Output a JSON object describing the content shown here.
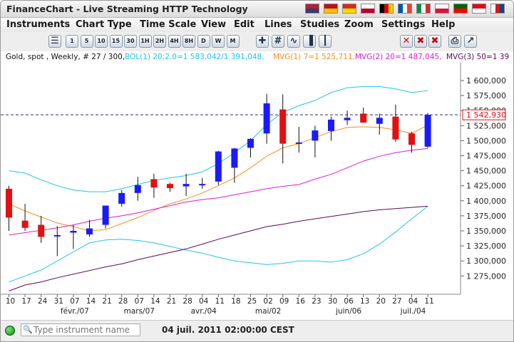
{
  "window": {
    "title": "FinanceChart - Live Streaming HTTP Technology"
  },
  "flags": [
    {
      "name": "us-flag-icon",
      "colors": [
        "#b22234",
        "#3c3b6e"
      ]
    },
    {
      "name": "es-flag-icon",
      "colors": [
        "#c60b1e",
        "#ffc400"
      ]
    },
    {
      "name": "cn-flag-icon",
      "colors": [
        "#de2910",
        "#ffde00"
      ]
    },
    {
      "name": "jp-flag-icon",
      "colors": [
        "#ffffff",
        "#bc002d"
      ]
    },
    {
      "name": "de-flag-icon",
      "colors": [
        "#000000",
        "#dd0000",
        "#ffce00"
      ]
    },
    {
      "name": "fr-flag-icon",
      "colors": [
        "#0055a4",
        "#ffffff",
        "#ef4135"
      ]
    },
    {
      "name": "it-flag-icon",
      "colors": [
        "#009246",
        "#ffffff",
        "#ce2b37"
      ]
    },
    {
      "name": "pl-flag-icon",
      "colors": [
        "#ffffff",
        "#dc143c"
      ]
    },
    {
      "name": "pt-flag-icon",
      "colors": [
        "#006600",
        "#ff0000"
      ]
    },
    {
      "name": "tr-flag-icon",
      "colors": [
        "#e30a17",
        "#ffffff"
      ]
    },
    {
      "name": "cz-flag-icon",
      "colors": [
        "#ffffff",
        "#d7141a",
        "#11457e"
      ]
    }
  ],
  "menu": [
    "Instruments",
    "Chart Type",
    "Time Scale",
    "View",
    "Edit",
    "Lines",
    "Studies",
    "Zoom",
    "Settings",
    "Help"
  ],
  "toolbar": {
    "scale_buttons": [
      "1",
      "5",
      "10",
      "15",
      "30",
      "1H",
      "2H",
      "4H",
      "8H",
      "D",
      "W",
      "M"
    ],
    "tool_icons": [
      "menu-icon",
      "crosshair-icon",
      "hash-icon",
      "line-chart-icon",
      "bar-chart-icon",
      "candlestick-icon",
      "erase-icon",
      "delete-icon",
      "close-icon",
      "print-icon",
      "pin-icon"
    ]
  },
  "legend": {
    "instrument": "Gold, spot , Weekly, # 27 / 300,",
    "bol": "BOL(1) 20;2.0=1 583,042/1 391,048,",
    "mvg1": "MVG(1) 7=1 525,711,",
    "mvg2": "MVG(2) 20=1 487,045,",
    "mvg3": "MVG(3) 50=1 39"
  },
  "colors": {
    "up": "#1a1aff",
    "down": "#e31010",
    "bol": "#1ec3f0",
    "mvg1": "#ff8c1a",
    "mvg2": "#d81ed8",
    "mvg3": "#5a0a5a",
    "current": "#2a2a7a"
  },
  "status": {
    "search_placeholder": "Type instrument name",
    "datetime": "04 juil. 2011 02:00:00 CEST"
  },
  "chart_data": {
    "type": "candlestick",
    "instrument": "Gold, spot",
    "timeframe": "Weekly",
    "ylim": [
      1255000,
      1615000
    ],
    "y_ticks": [
      "1 275,000",
      "1 300,000",
      "1 325,000",
      "1 350,000",
      "1 375,000",
      "1 400,000",
      "1 425,000",
      "1 450,000",
      "1 475,000",
      "1 500,000",
      "1 525,000",
      "1 550,000",
      "1 575,000",
      "1 600,000"
    ],
    "x_ticks": [
      "10",
      "17",
      "24",
      "31",
      "07",
      "14",
      "21",
      "28",
      "07",
      "14",
      "21",
      "28",
      "04",
      "11",
      "18",
      "25",
      "02",
      "09",
      "16",
      "23",
      "30",
      "06",
      "13",
      "20",
      "27",
      "04",
      "11"
    ],
    "month_labels": [
      {
        "label": "févr./07",
        "at": 4
      },
      {
        "label": "mars/07",
        "at": 8
      },
      {
        "label": "avr./04",
        "at": 12
      },
      {
        "label": "mai/02",
        "at": 16
      },
      {
        "label": "juin/06",
        "at": 21
      },
      {
        "label": "juil./04",
        "at": 25
      }
    ],
    "current_price_label": "1 542,930",
    "current_price": 1542930,
    "candles": [
      {
        "o": 1420000,
        "h": 1425000,
        "l": 1350000,
        "c": 1372000
      },
      {
        "o": 1367000,
        "h": 1395000,
        "l": 1350000,
        "c": 1355000
      },
      {
        "o": 1360000,
        "h": 1375000,
        "l": 1330000,
        "c": 1340000
      },
      {
        "o": 1343000,
        "h": 1358000,
        "l": 1308000,
        "c": 1343000
      },
      {
        "o": 1347000,
        "h": 1360000,
        "l": 1320000,
        "c": 1350000
      },
      {
        "o": 1344000,
        "h": 1368000,
        "l": 1340000,
        "c": 1354000
      },
      {
        "o": 1360000,
        "h": 1392000,
        "l": 1354000,
        "c": 1392000
      },
      {
        "o": 1395000,
        "h": 1418000,
        "l": 1390000,
        "c": 1413000
      },
      {
        "o": 1413000,
        "h": 1440000,
        "l": 1400000,
        "c": 1426000
      },
      {
        "o": 1436000,
        "h": 1445000,
        "l": 1405000,
        "c": 1422000
      },
      {
        "o": 1428000,
        "h": 1430000,
        "l": 1415000,
        "c": 1421000
      },
      {
        "o": 1424000,
        "h": 1445000,
        "l": 1408000,
        "c": 1428000
      },
      {
        "o": 1428000,
        "h": 1438000,
        "l": 1420000,
        "c": 1428000
      },
      {
        "o": 1432000,
        "h": 1483000,
        "l": 1426000,
        "c": 1482000
      },
      {
        "o": 1455000,
        "h": 1488000,
        "l": 1430000,
        "c": 1487000
      },
      {
        "o": 1488000,
        "h": 1504000,
        "l": 1472000,
        "c": 1503000
      },
      {
        "o": 1512000,
        "h": 1578000,
        "l": 1495000,
        "c": 1562000
      },
      {
        "o": 1552000,
        "h": 1577000,
        "l": 1462000,
        "c": 1495000
      },
      {
        "o": 1495000,
        "h": 1523000,
        "l": 1480000,
        "c": 1497000
      },
      {
        "o": 1500000,
        "h": 1525000,
        "l": 1472000,
        "c": 1517000
      },
      {
        "o": 1516000,
        "h": 1540000,
        "l": 1500000,
        "c": 1535000
      },
      {
        "o": 1534000,
        "h": 1550000,
        "l": 1526000,
        "c": 1538000
      },
      {
        "o": 1545000,
        "h": 1555000,
        "l": 1530000,
        "c": 1530000
      },
      {
        "o": 1528000,
        "h": 1545000,
        "l": 1510000,
        "c": 1538000
      },
      {
        "o": 1540000,
        "h": 1560000,
        "l": 1498000,
        "c": 1502000
      },
      {
        "o": 1512000,
        "h": 1515000,
        "l": 1480000,
        "c": 1493000
      },
      {
        "o": 1490000,
        "h": 1546000,
        "l": 1488000,
        "c": 1543000
      }
    ],
    "series": [
      {
        "name": "BOL(1) upper",
        "values": [
          1450000,
          1446000,
          1435000,
          1425000,
          1418000,
          1415000,
          1415000,
          1420000,
          1427000,
          1434000,
          1438000,
          1442000,
          1448000,
          1462000,
          1480000,
          1500000,
          1527000,
          1547000,
          1558000,
          1567000,
          1580000,
          1588000,
          1590000,
          1590000,
          1586000,
          1580000,
          1583000
        ]
      },
      {
        "name": "BOL(1) lower",
        "values": [
          1265000,
          1275000,
          1285000,
          1300000,
          1315000,
          1330000,
          1335000,
          1336000,
          1334000,
          1330000,
          1324000,
          1318000,
          1313000,
          1306000,
          1300000,
          1297000,
          1294000,
          1296000,
          1300000,
          1300000,
          1298000,
          1302000,
          1312000,
          1328000,
          1348000,
          1370000,
          1391000
        ]
      },
      {
        "name": "MVG(1) 7",
        "values": [
          1395000,
          1383000,
          1373000,
          1363000,
          1357000,
          1350000,
          1352000,
          1362000,
          1372000,
          1384000,
          1395000,
          1403000,
          1413000,
          1425000,
          1438000,
          1455000,
          1474000,
          1488000,
          1495000,
          1505000,
          1515000,
          1522000,
          1523000,
          1522000,
          1518000,
          1512000,
          1526000
        ]
      },
      {
        "name": "MVG(2) 20",
        "values": [
          1343000,
          1347000,
          1351000,
          1355000,
          1360000,
          1366000,
          1371000,
          1375000,
          1380000,
          1386000,
          1392000,
          1398000,
          1402000,
          1405000,
          1410000,
          1415000,
          1420000,
          1424000,
          1427000,
          1436000,
          1444000,
          1455000,
          1466000,
          1474000,
          1480000,
          1484000,
          1487000
        ]
      },
      {
        "name": "MVG(3) 50",
        "values": [
          1250000,
          1260000,
          1265000,
          1272000,
          1278000,
          1284000,
          1290000,
          1295000,
          1302000,
          1308000,
          1314000,
          1320000,
          1328000,
          1336000,
          1343000,
          1350000,
          1357000,
          1361000,
          1366000,
          1370000,
          1374000,
          1378000,
          1382000,
          1385000,
          1387000,
          1389000,
          1391000
        ]
      }
    ]
  }
}
